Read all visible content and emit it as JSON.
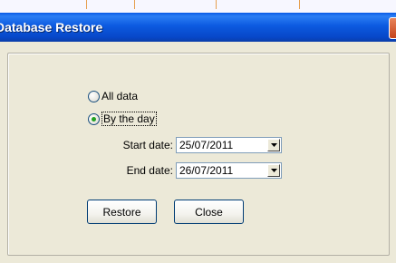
{
  "window": {
    "title": "Database Restore"
  },
  "options": {
    "all_data_label": "All data",
    "by_day_label": "By the day",
    "selected": "by_day"
  },
  "dates": {
    "start_label": "Start date:",
    "start_value": "25/07/2011",
    "end_label": "End date:",
    "end_value": "26/07/2011"
  },
  "buttons": {
    "restore_label": "Restore",
    "close_label": "Close"
  },
  "icons": {
    "dropdown": "chevron-down-icon",
    "close": "close-icon"
  },
  "colors": {
    "titlebar": "#0747c8",
    "radio_checked": "#21a121",
    "combo_border": "#7f9db9",
    "button_border": "#003c74"
  }
}
